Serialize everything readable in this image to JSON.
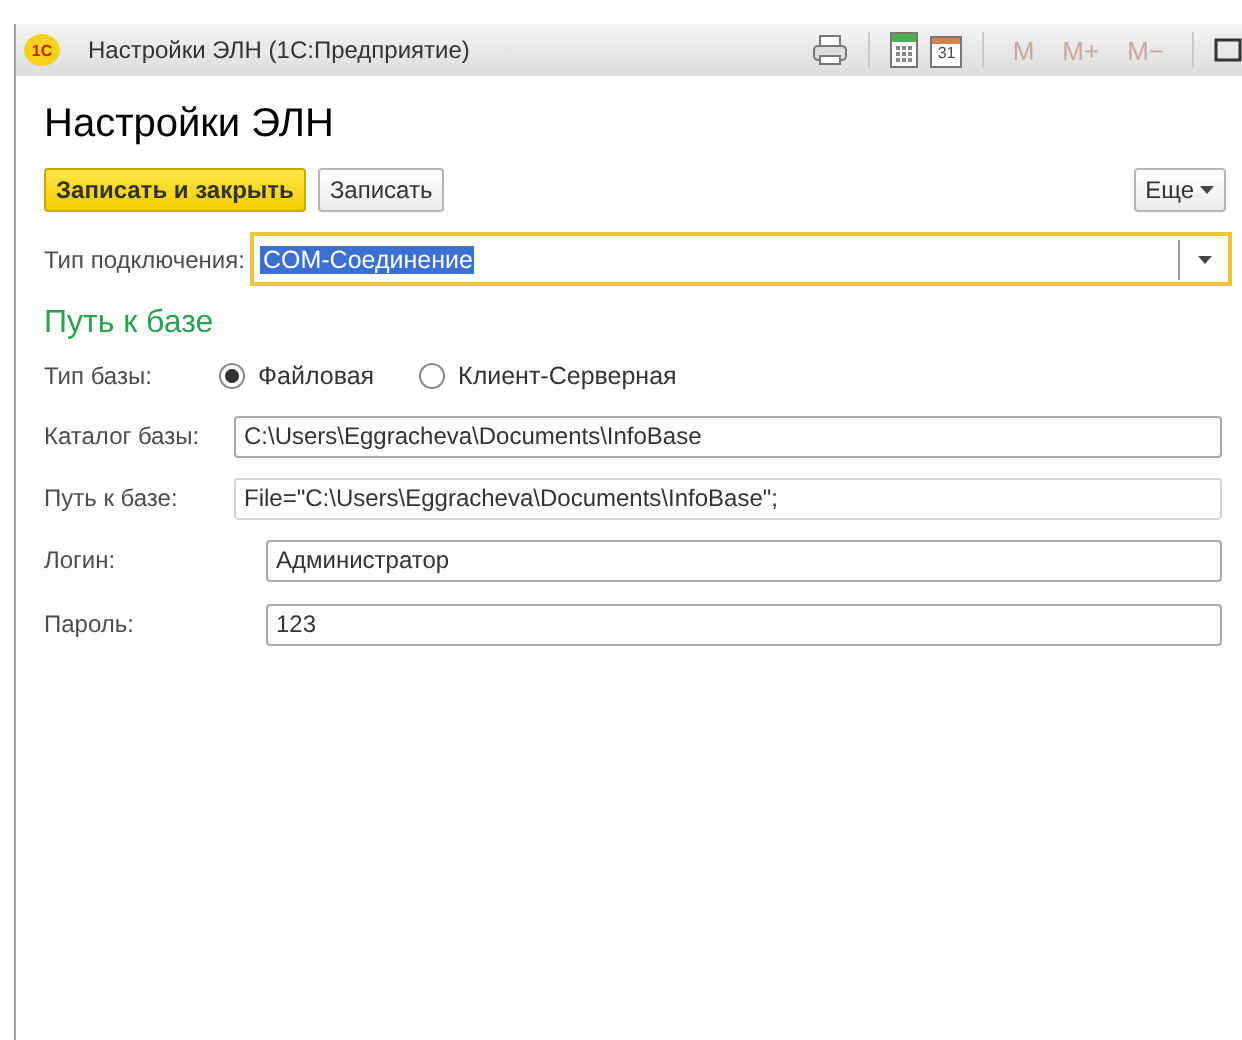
{
  "window": {
    "title": "Настройки ЭЛН  (1С:Предприятие)",
    "logo": "1С",
    "toolbar": {
      "calendar_day": "31",
      "memory_buttons": [
        "M",
        "M+",
        "M−"
      ]
    }
  },
  "form_title": "Настройки ЭЛН",
  "command_bar": {
    "buttons": [
      {
        "label": "Записать и закрыть",
        "kind": "primary"
      },
      {
        "label": "Записать",
        "kind": "normal"
      }
    ],
    "more": "Еще"
  },
  "connection": {
    "label": "Тип подключения:",
    "value": "COM-Соединение",
    "focused": true,
    "selected_text": true
  },
  "section_title": "Путь к базе",
  "base_type": {
    "label": "Тип базы:",
    "options": [
      {
        "label": "Файловая",
        "selected": true
      },
      {
        "label": "Клиент-Серверная",
        "selected": false
      }
    ]
  },
  "path_fields": [
    {
      "label": "Каталог базы:",
      "value": "C:\\Users\\Eggracheva\\Documents\\InfoBase",
      "readonly": false
    },
    {
      "label": "Путь к базе:",
      "value": "File=\"C:\\Users\\Eggracheva\\Documents\\InfoBase\";",
      "readonly": true
    }
  ],
  "credential_fields": [
    {
      "label": "Логин:",
      "value": "Администратор",
      "readonly": false
    },
    {
      "label": "Пароль:",
      "value": "123",
      "readonly": false
    }
  ]
}
